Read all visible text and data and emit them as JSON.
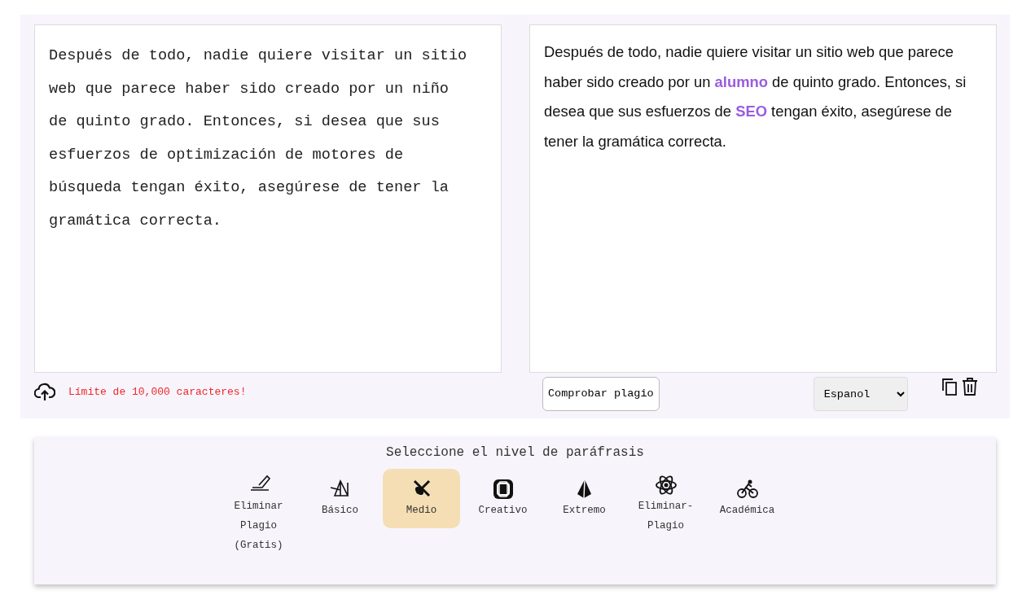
{
  "input": {
    "value": "Después de todo, nadie quiere visitar un sitio web que parece haber sido creado por un niño de quinto grado. Entonces, si desea que sus esfuerzos de optimización de motores de búsqueda tengan éxito, asegúrese de tener la gramática correcta."
  },
  "output": {
    "segments": [
      {
        "text": "Después de todo, nadie quiere visitar un sitio web que parece haber sido creado por un ",
        "changed": false
      },
      {
        "text": "alumno",
        "changed": true
      },
      {
        "text": " de quinto grado. Entonces, si desea que sus esfuerzos de ",
        "changed": false
      },
      {
        "text": "SEO",
        "changed": true
      },
      {
        "text": " tengan éxito, asegúrese de tener la gramática correcta.",
        "changed": false
      }
    ]
  },
  "char_limit": "Límite de 10,000 caracteres!",
  "check_button": "Comprobar plagio",
  "language": {
    "value": "Espanol"
  },
  "levels": {
    "title": "Seleccione el nivel de paráfrasis",
    "items": [
      {
        "label": "Eliminar Plagio (Gratis)",
        "selected": false
      },
      {
        "label": "Básico",
        "selected": false
      },
      {
        "label": "Medio",
        "selected": true
      },
      {
        "label": "Creativo",
        "selected": false
      },
      {
        "label": "Extremo",
        "selected": false
      },
      {
        "label": "Eliminar-Plagio",
        "selected": false
      },
      {
        "label": "Académica",
        "selected": false
      }
    ]
  }
}
